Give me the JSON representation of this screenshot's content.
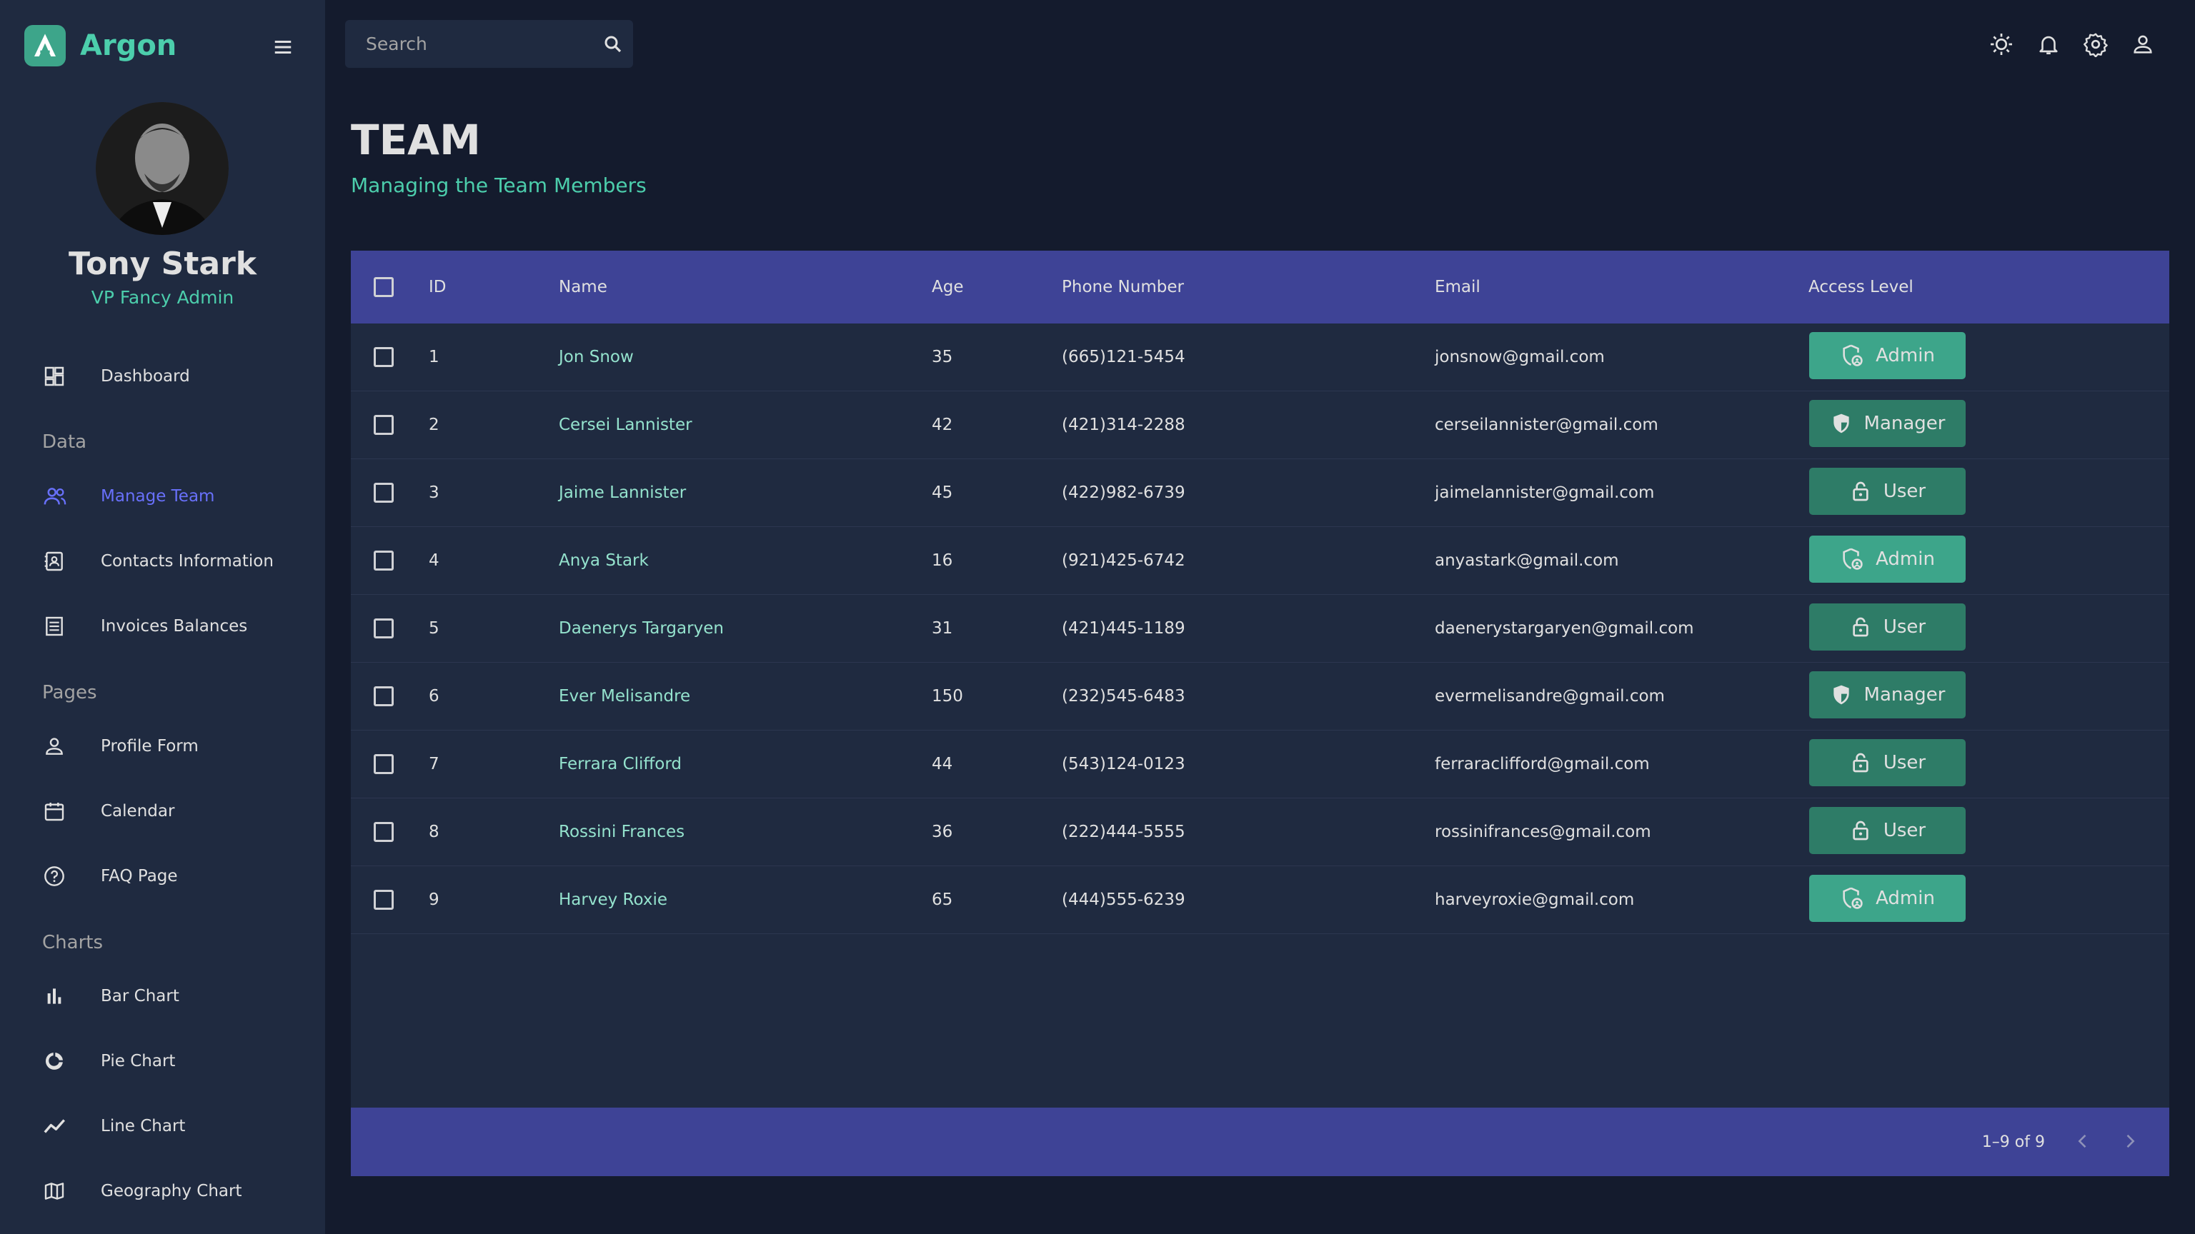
{
  "brand": {
    "name": "Argon"
  },
  "profile": {
    "name": "Tony Stark",
    "role": "VP Fancy Admin"
  },
  "search": {
    "placeholder": "Search"
  },
  "sidebar": {
    "dashboard": "Dashboard",
    "sections": {
      "data": "Data",
      "pages": "Pages",
      "charts": "Charts"
    },
    "data_items": [
      "Manage Team",
      "Contacts Information",
      "Invoices Balances"
    ],
    "pages_items": [
      "Profile Form",
      "Calendar",
      "FAQ Page"
    ],
    "charts_items": [
      "Bar Chart",
      "Pie Chart",
      "Line Chart",
      "Geography Chart"
    ]
  },
  "page": {
    "title": "TEAM",
    "subtitle": "Managing the Team Members"
  },
  "table": {
    "columns": [
      "ID",
      "Name",
      "Age",
      "Phone Number",
      "Email",
      "Access Level"
    ],
    "rows": [
      {
        "id": "1",
        "name": "Jon Snow",
        "age": "35",
        "phone": "(665)121-5454",
        "email": "jonsnow@gmail.com",
        "access": "Admin"
      },
      {
        "id": "2",
        "name": "Cersei Lannister",
        "age": "42",
        "phone": "(421)314-2288",
        "email": "cerseilannister@gmail.com",
        "access": "Manager"
      },
      {
        "id": "3",
        "name": "Jaime Lannister",
        "age": "45",
        "phone": "(422)982-6739",
        "email": "jaimelannister@gmail.com",
        "access": "User"
      },
      {
        "id": "4",
        "name": "Anya Stark",
        "age": "16",
        "phone": "(921)425-6742",
        "email": "anyastark@gmail.com",
        "access": "Admin"
      },
      {
        "id": "5",
        "name": "Daenerys Targaryen",
        "age": "31",
        "phone": "(421)445-1189",
        "email": "daenerystargaryen@gmail.com",
        "access": "User"
      },
      {
        "id": "6",
        "name": "Ever Melisandre",
        "age": "150",
        "phone": "(232)545-6483",
        "email": "evermelisandre@gmail.com",
        "access": "Manager"
      },
      {
        "id": "7",
        "name": "Ferrara Clifford",
        "age": "44",
        "phone": "(543)124-0123",
        "email": "ferraraclifford@gmail.com",
        "access": "User"
      },
      {
        "id": "8",
        "name": "Rossini Frances",
        "age": "36",
        "phone": "(222)444-5555",
        "email": "rossinifrances@gmail.com",
        "access": "User"
      },
      {
        "id": "9",
        "name": "Harvey Roxie",
        "age": "65",
        "phone": "(444)555-6239",
        "email": "harveyroxie@gmail.com",
        "access": "Admin"
      }
    ],
    "pagination": "1–9 of 9"
  },
  "colors": {
    "background": "#141b2d",
    "panel": "#1f2a40",
    "accent_green": "#4cceac",
    "admin_button": "#3da58a",
    "role_button": "#2e7c67",
    "header_blue": "#3e4396",
    "active_nav": "#6870fa"
  },
  "icons": {
    "topbar": [
      "light-mode-icon",
      "notifications-icon",
      "settings-icon",
      "person-icon"
    ],
    "access": {
      "Admin": "admin-panel-icon",
      "Manager": "security-shield-icon",
      "User": "lock-open-icon"
    }
  }
}
